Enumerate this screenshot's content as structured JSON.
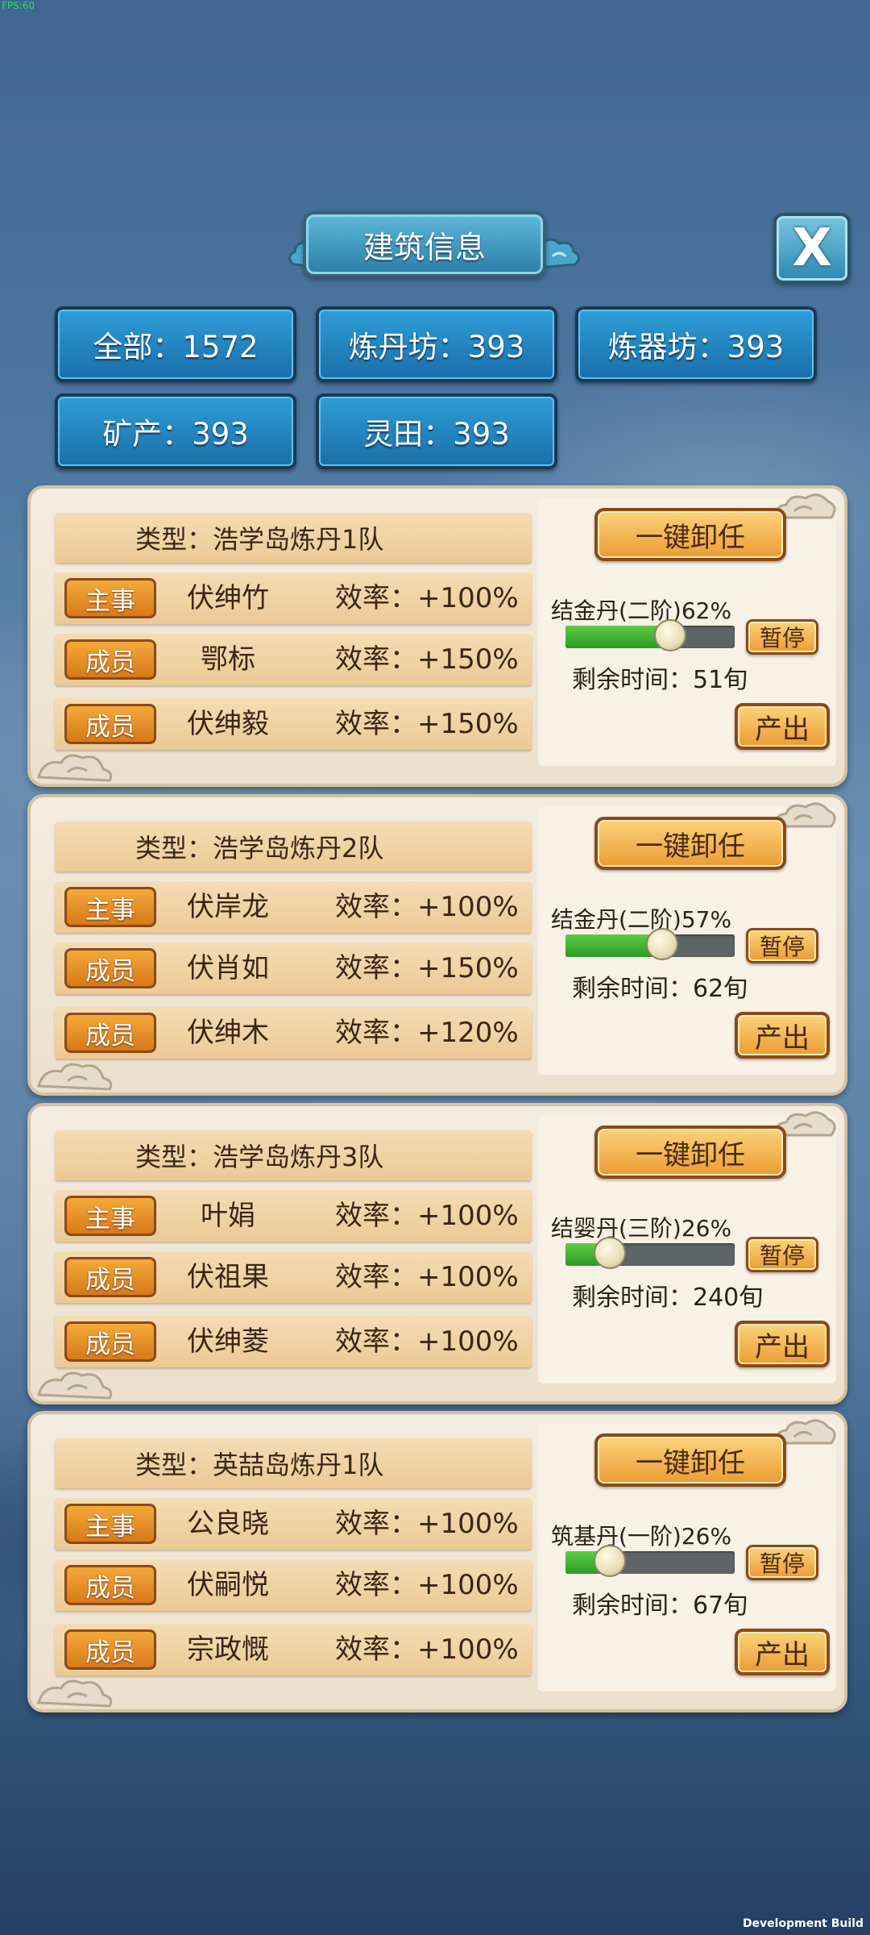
{
  "debug": {
    "fps": "FPS:60",
    "build": "Development Build"
  },
  "header": {
    "title": "建筑信息",
    "close_label": "X"
  },
  "stats": [
    {
      "label": "全部：1572"
    },
    {
      "label": "炼丹坊：393"
    },
    {
      "label": "炼器坊：393"
    },
    {
      "label": "矿产：393"
    },
    {
      "label": "灵田：393"
    }
  ],
  "teams": [
    {
      "type": "类型：浩学岛炼丹1队",
      "unload": "一键卸任",
      "members": [
        {
          "role": "主事",
          "name": "伏绅竹",
          "efficiency": "效率：+100%"
        },
        {
          "role": "成员",
          "name": "鄂标",
          "efficiency": "效率：+150%"
        },
        {
          "role": "成员",
          "name": "伏绅毅",
          "efficiency": "效率：+150%"
        }
      ],
      "product": "结金丹(二阶)62%",
      "progress": 0.62,
      "pause": "暂停",
      "remaining": "剩余时间：51旬",
      "produce": "产出"
    },
    {
      "type": "类型：浩学岛炼丹2队",
      "unload": "一键卸任",
      "members": [
        {
          "role": "主事",
          "name": "伏岸龙",
          "efficiency": "效率：+100%"
        },
        {
          "role": "成员",
          "name": "伏肖如",
          "efficiency": "效率：+150%"
        },
        {
          "role": "成员",
          "name": "伏绅木",
          "efficiency": "效率：+120%"
        }
      ],
      "product": "结金丹(二阶)57%",
      "progress": 0.57,
      "pause": "暂停",
      "remaining": "剩余时间：62旬",
      "produce": "产出"
    },
    {
      "type": "类型：浩学岛炼丹3队",
      "unload": "一键卸任",
      "members": [
        {
          "role": "主事",
          "name": "叶娟",
          "efficiency": "效率：+100%"
        },
        {
          "role": "成员",
          "name": "伏祖果",
          "efficiency": "效率：+100%"
        },
        {
          "role": "成员",
          "name": "伏绅菱",
          "efficiency": "效率：+100%"
        }
      ],
      "product": "结婴丹(三阶)26%",
      "progress": 0.26,
      "pause": "暂停",
      "remaining": "剩余时间：240旬",
      "produce": "产出"
    },
    {
      "type": "类型：英喆岛炼丹1队",
      "unload": "一键卸任",
      "members": [
        {
          "role": "主事",
          "name": "公良晓",
          "efficiency": "效率：+100%"
        },
        {
          "role": "成员",
          "name": "伏嗣悦",
          "efficiency": "效率：+100%"
        },
        {
          "role": "成员",
          "name": "宗政慨",
          "efficiency": "效率：+100%"
        }
      ],
      "product": "筑基丹(一阶)26%",
      "progress": 0.26,
      "pause": "暂停",
      "remaining": "剩余时间：67旬",
      "produce": "产出"
    }
  ],
  "colors": {
    "progress_fill": "#3fb533",
    "button_orange": "#eb9c35",
    "stat_blue": "#1f82c0"
  }
}
